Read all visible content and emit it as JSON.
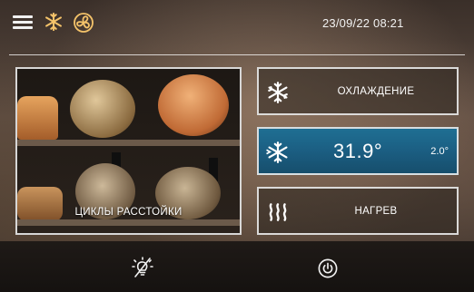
{
  "header": {
    "datetime": "23/09/22 08:21",
    "icons": [
      "menu-icon",
      "snowflake-icon",
      "fan-icon"
    ]
  },
  "cycles_card": {
    "label": "ЦИКЛЫ РАССТОЙКИ"
  },
  "cooling_card": {
    "label": "ОХЛАЖДЕНИЕ",
    "icon": "snowflake-icon"
  },
  "temperature_card": {
    "value": "31.9°",
    "differential": "2.0°",
    "icon": "snowflake-fan-icon"
  },
  "heating_card": {
    "label": "НАГРЕВ",
    "icon": "heat-waves-icon"
  },
  "footer": {
    "icons": [
      "light-off-icon",
      "power-icon"
    ]
  },
  "colors": {
    "accent_icon": "#f4c36a",
    "active_card": "#1b5e82",
    "text": "#ffffff"
  }
}
